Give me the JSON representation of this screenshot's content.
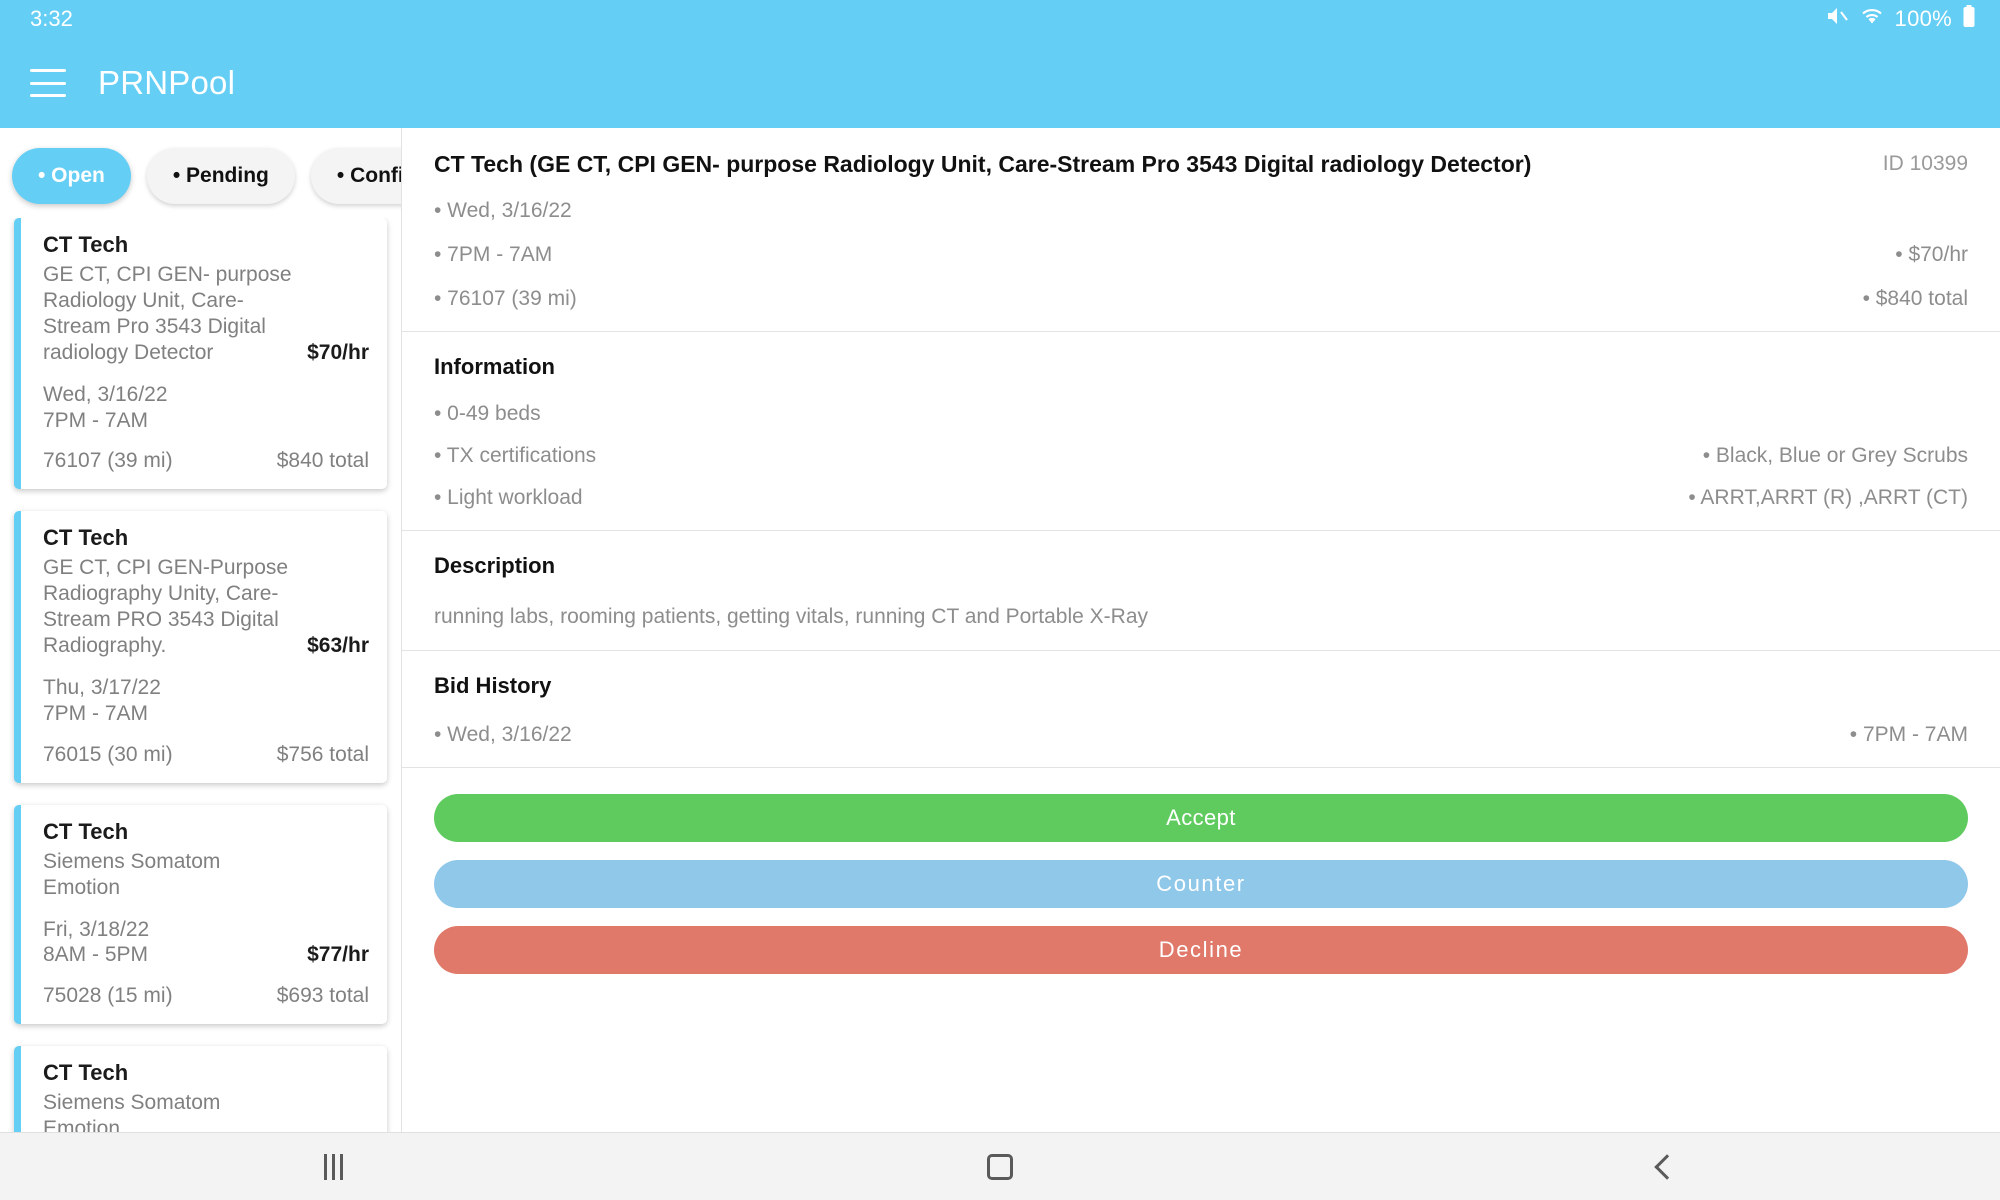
{
  "statusbar": {
    "time": "3:32",
    "battery": "100%",
    "mute_icon": "mute-icon",
    "wifi_icon": "wifi-icon",
    "battery_icon": "battery-icon"
  },
  "appbar": {
    "menu_icon": "hamburger-menu-icon",
    "title": "PRNPool"
  },
  "filters": [
    {
      "label": "• Open",
      "active": true
    },
    {
      "label": "• Pending",
      "active": false
    },
    {
      "label": "• Confirmed",
      "active": false
    }
  ],
  "job_cards": [
    {
      "role": "CT Tech",
      "equipment": "GE CT, CPI GEN- purpose Radiology Unit, Care-Stream Pro 3543 Digital radiology Detector",
      "rate": "$70/hr",
      "date": "Wed, 3/16/22",
      "time": "7PM - 7AM",
      "location": "76107 (39 mi)",
      "total": "$840 total"
    },
    {
      "role": "CT Tech",
      "equipment": "GE CT, CPI GEN-Purpose Radiography Unity, Care-Stream PRO 3543 Digital Radiography.",
      "rate": "$63/hr",
      "date": "Thu, 3/17/22",
      "time": "7PM - 7AM",
      "location": "76015 (30 mi)",
      "total": "$756 total"
    },
    {
      "role": "CT Tech",
      "equipment": "Siemens Somatom Emotion",
      "rate": "$77/hr",
      "date": "Fri, 3/18/22",
      "time": "8AM - 5PM",
      "location": "75028 (15 mi)",
      "total": "$693 total"
    },
    {
      "role": "CT Tech",
      "equipment": "Siemens Somatom Emotion",
      "rate": "",
      "date": "",
      "time": "",
      "location": "",
      "total": ""
    }
  ],
  "detail": {
    "title": "CT Tech (GE CT, CPI GEN- purpose Radiology Unit, Care-Stream Pro 3543 Digital radiology Detector)",
    "id": "ID 10399",
    "rows": [
      {
        "left": "• Wed, 3/16/22",
        "right": ""
      },
      {
        "left": "• 7PM - 7AM",
        "right": "• $70/hr"
      },
      {
        "left": "• 76107 (39 mi)",
        "right": "• $840 total"
      }
    ],
    "information": {
      "heading": "Information",
      "rows": [
        {
          "left": "• 0-49 beds",
          "right": ""
        },
        {
          "left": "• TX certifications",
          "right": "• Black, Blue or Grey Scrubs"
        },
        {
          "left": "• Light workload",
          "right": "• ARRT,ARRT (R) ,ARRT (CT)"
        }
      ]
    },
    "description": {
      "heading": "Description",
      "text": "running labs, rooming patients, getting vitals, running CT and Portable X-Ray"
    },
    "bid_history": {
      "heading": "Bid History",
      "rows": [
        {
          "left": "• Wed, 3/16/22",
          "right": "• 7PM - 7AM"
        }
      ]
    },
    "actions": {
      "accept": "Accept",
      "counter": "Counter",
      "decline": "Decline"
    }
  },
  "navbar": {
    "recent_icon": "recent-apps-icon",
    "home_icon": "home-icon",
    "back_icon": "back-icon"
  },
  "colors": {
    "brand": "#64CEF5",
    "accept": "#5FCB5F",
    "counter": "#90C8EA",
    "decline": "#E0796A"
  }
}
